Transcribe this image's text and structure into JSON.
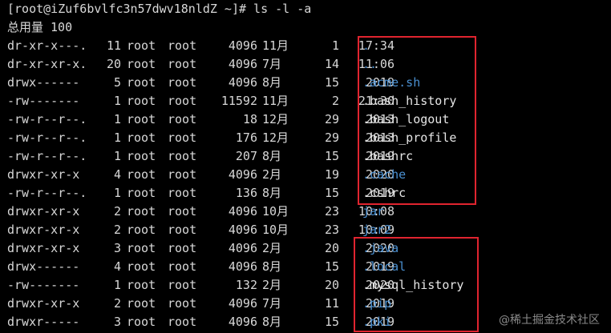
{
  "terminal": {
    "background": "#000000",
    "prompt": "[root@iZuf6bvlfc3n57dwv18nldZ ~]# ls -l -a",
    "total": "总用量 100",
    "entries": [
      {
        "perms": "dr-xr-x---.",
        "links": "11",
        "owner": "root",
        "group": "root",
        "size": "4096",
        "month": "11月",
        "day": "1",
        "time": "17:34",
        "name": ".",
        "kind": "dir"
      },
      {
        "perms": "dr-xr-xr-x.",
        "links": "20",
        "owner": "root",
        "group": "root",
        "size": "4096",
        "month": "7月",
        "day": "14",
        "time": "11:06",
        "name": "..",
        "kind": "dir"
      },
      {
        "perms": "drwx------",
        "links": "5",
        "owner": "root",
        "group": "root",
        "size": "4096",
        "month": "8月",
        "day": "15",
        "time": "2019",
        "name": ".acme.sh",
        "kind": "dir"
      },
      {
        "perms": "-rw-------",
        "links": "1",
        "owner": "root",
        "group": "root",
        "size": "11592",
        "month": "11月",
        "day": "2",
        "time": "21:30",
        "name": ".bash_history",
        "kind": "file"
      },
      {
        "perms": "-rw-r--r--.",
        "links": "1",
        "owner": "root",
        "group": "root",
        "size": "18",
        "month": "12月",
        "day": "29",
        "time": "2013",
        "name": ".bash_logout",
        "kind": "file"
      },
      {
        "perms": "-rw-r--r--.",
        "links": "1",
        "owner": "root",
        "group": "root",
        "size": "176",
        "month": "12月",
        "day": "29",
        "time": "2013",
        "name": ".bash_profile",
        "kind": "file"
      },
      {
        "perms": "-rw-r--r--.",
        "links": "1",
        "owner": "root",
        "group": "root",
        "size": "207",
        "month": "8月",
        "day": "15",
        "time": "2019",
        "name": ".bashrc",
        "kind": "file"
      },
      {
        "perms": "drwxr-xr-x",
        "links": "4",
        "owner": "root",
        "group": "root",
        "size": "4096",
        "month": "2月",
        "day": "19",
        "time": "2020",
        "name": ".cache",
        "kind": "dir"
      },
      {
        "perms": "-rw-r--r--.",
        "links": "1",
        "owner": "root",
        "group": "root",
        "size": "136",
        "month": "8月",
        "day": "15",
        "time": "2019",
        "name": ".cshrc",
        "kind": "file"
      },
      {
        "perms": "drwxr-xr-x",
        "links": "2",
        "owner": "root",
        "group": "root",
        "size": "4096",
        "month": "10月",
        "day": "23",
        "time": "10:08",
        "name": "jar",
        "kind": "dir"
      },
      {
        "perms": "drwxr-xr-x",
        "links": "2",
        "owner": "root",
        "group": "root",
        "size": "4096",
        "month": "10月",
        "day": "23",
        "time": "10:09",
        "name": "jar2",
        "kind": "dir"
      },
      {
        "perms": "drwxr-xr-x",
        "links": "3",
        "owner": "root",
        "group": "root",
        "size": "4096",
        "month": "2月",
        "day": "20",
        "time": "2020",
        "name": ".java",
        "kind": "dir"
      },
      {
        "perms": "drwx------",
        "links": "4",
        "owner": "root",
        "group": "root",
        "size": "4096",
        "month": "8月",
        "day": "15",
        "time": "2019",
        "name": ".local",
        "kind": "dir"
      },
      {
        "perms": "-rw-------",
        "links": "1",
        "owner": "root",
        "group": "root",
        "size": "132",
        "month": "2月",
        "day": "20",
        "time": "2020",
        "name": ".mysql_history",
        "kind": "file"
      },
      {
        "perms": "drwxr-xr-x",
        "links": "2",
        "owner": "root",
        "group": "root",
        "size": "4096",
        "month": "7月",
        "day": "11",
        "time": "2019",
        "name": ".pip",
        "kind": "dir"
      },
      {
        "perms": "drwxr-----",
        "links": "3",
        "owner": "root",
        "group": "root",
        "size": "4096",
        "month": "8月",
        "day": "15",
        "time": "2019",
        "name": ".pki",
        "kind": "dir"
      }
    ]
  },
  "annotations": {
    "highlight_color": "#e0242f"
  },
  "watermark": {
    "text": "@稀土掘金技术社区"
  },
  "colors": {
    "directory": "#4a8fd0",
    "file": "#e6e6e6",
    "text": "#d8d8d8"
  }
}
